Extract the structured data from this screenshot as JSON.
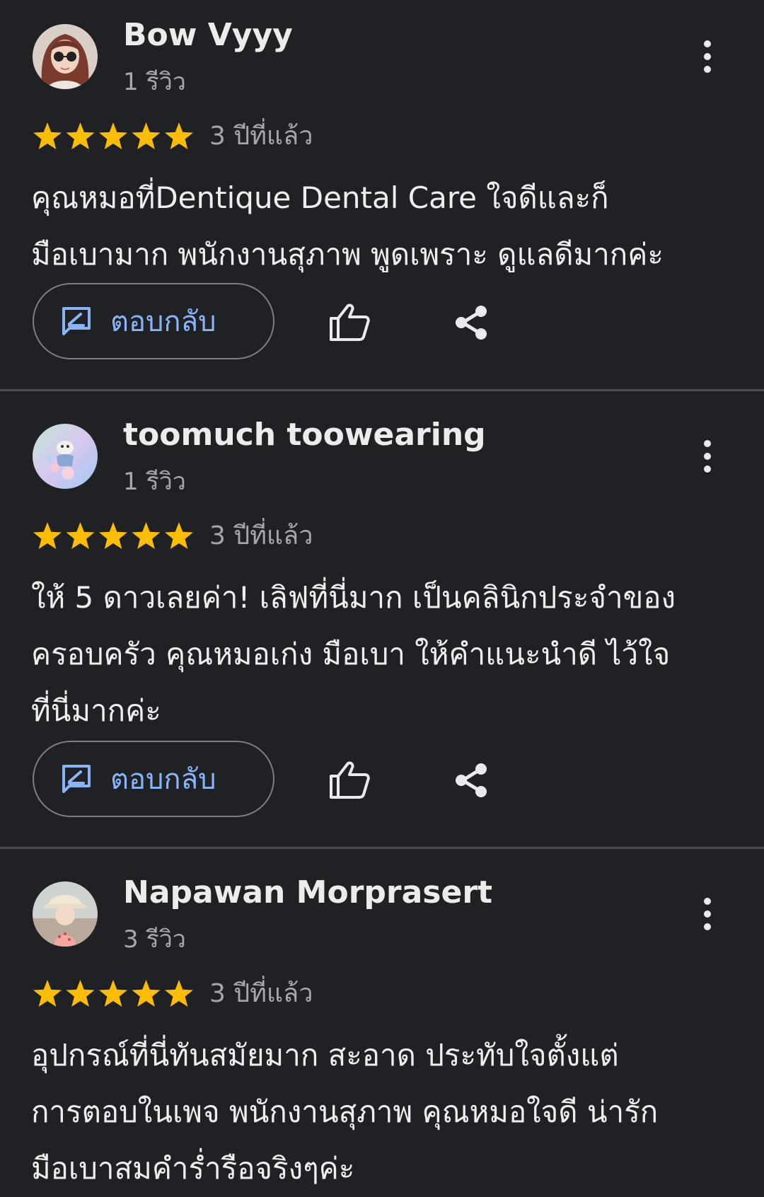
{
  "reviews": [
    {
      "name": "Bow Vyyy",
      "review_count": "1 รีวิว",
      "rating": 5,
      "date": "3 ปีที่แล้ว",
      "text_lines": [
        "คุณหมอที่Dentique Dental Care ใจดีและก็",
        "มือเบามาก พนักงานสุภาพ พูดเพราะ ดูแลดีมากค่ะ"
      ],
      "reply_label": "ตอบกลับ",
      "avatar_icon": "avatar-woman-sunglasses"
    },
    {
      "name": "toomuch toowearing",
      "review_count": "1 รีวิว",
      "rating": 5,
      "date": "3 ปีที่แล้ว",
      "text_lines": [
        "ให้ 5 ดาวเลยค่า! เลิฟที่นี่มาก เป็นคลินิกประจำของ",
        "ครอบครัว คุณหมอเก่ง มือเบา ให้คำแนะนำดี ไว้ใจ",
        "ที่นี่มากค่ะ"
      ],
      "reply_label": "ตอบกลับ",
      "avatar_icon": "avatar-pastel-character"
    },
    {
      "name": "Napawan Morprasert",
      "review_count": "3 รีวิว",
      "rating": 5,
      "date": "3 ปีที่แล้ว",
      "text_lines": [
        "อุปกรณ์ที่นี่ทันสมัยมาก สะอาด ประทับใจตั้งแต่",
        "การตอบในเพจ พนักงานสุภาพ คุณหมอใจดี น่ารัก",
        "มือเบาสมคำร่ำรือจริงๆค่ะ"
      ],
      "reply_label": "",
      "avatar_icon": "avatar-child-hat"
    }
  ],
  "colors": {
    "background": "#202124",
    "star": "#fbbc04",
    "link": "#8ab4f8",
    "secondary_text": "#a4a7ab",
    "divider": "#4a4c50"
  }
}
